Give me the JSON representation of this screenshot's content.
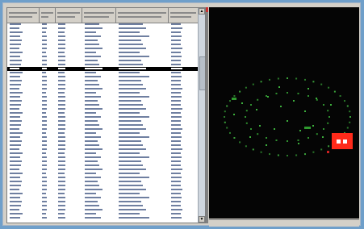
{
  "table": {
    "columns": [
      {
        "name": "col-1",
        "width": 40
      },
      {
        "name": "col-2",
        "width": 20
      },
      {
        "name": "col-3",
        "width": 33
      },
      {
        "name": "col-4",
        "width": 42
      },
      {
        "name": "col-5",
        "width": 65
      },
      {
        "name": "col-6",
        "width": 37
      }
    ],
    "row_count": 49,
    "selected_row": 11
  },
  "map": {
    "background": "#050505",
    "dot_color": "#2f8f2f",
    "marker_color": "#ff2a1a",
    "marker_icon": "target-marker-icon"
  },
  "statusbar": {
    "left_text": "",
    "right_text": ""
  }
}
